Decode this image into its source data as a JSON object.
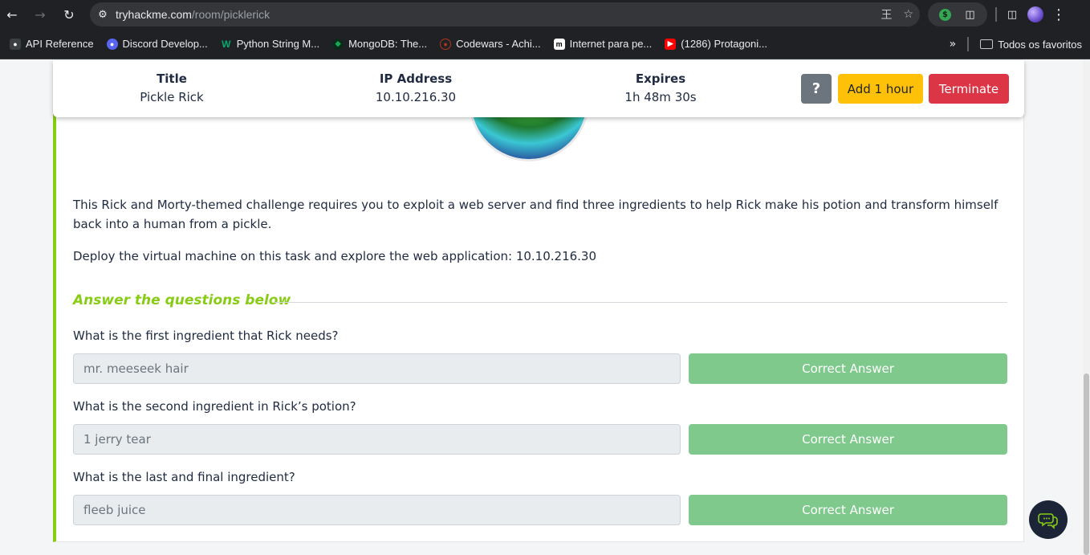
{
  "browser": {
    "url_host": "tryhackme.com",
    "url_path": "/room/picklerick",
    "bookmarks": [
      {
        "label": "API Reference",
        "icon": "api-icon",
        "color": "#5f6368"
      },
      {
        "label": "Discord Develop...",
        "icon": "discord-icon",
        "color": "#5865f2"
      },
      {
        "label": "Python String M...",
        "icon": "w3-icon",
        "color": "#04aa6d"
      },
      {
        "label": "MongoDB: The...",
        "icon": "mongodb-leaf-icon",
        "color": "#13aa52"
      },
      {
        "label": "Codewars - Achi...",
        "icon": "codewars-icon",
        "color": "#b1361e"
      },
      {
        "label": "Internet para pe...",
        "icon": "m-icon",
        "color": "#000000"
      },
      {
        "label": "(1286) Protagoni...",
        "icon": "youtube-icon",
        "color": "#ff0000"
      }
    ],
    "all_bookmarks_label": "Todos os favoritos"
  },
  "machine_bar": {
    "title_label": "Title",
    "title_value": "Pickle Rick",
    "ip_label": "IP Address",
    "ip_value": "10.10.216.30",
    "expires_label": "Expires",
    "expires_value": "1h 48m 30s",
    "help_label": "?",
    "add_hour_label": "Add 1 hour",
    "terminate_label": "Terminate"
  },
  "task": {
    "description": "This Rick and Morty-themed challenge requires you to exploit a web server and find three ingredients to help Rick make his potion and transform himself back into a human from a pickle.",
    "deploy_text": "Deploy the virtual machine on this task and explore the web application: 10.10.216.30",
    "answer_heading": "Answer the questions below",
    "questions": [
      {
        "question": "What is the first ingredient that Rick needs?",
        "answer": "mr. meeseek hair",
        "status": "Correct Answer"
      },
      {
        "question": "What is the second ingredient in Rick’s potion?",
        "answer": "1 jerry tear",
        "status": "Correct Answer"
      },
      {
        "question": "What is the last and final ingredient?",
        "answer": "fleeb juice",
        "status": "Correct Answer"
      }
    ]
  },
  "colors": {
    "accent_green": "#88cc14",
    "correct_green": "#7fc98c",
    "add_hour_yellow": "#ffc107",
    "terminate_red": "#dc3545",
    "help_gray": "#6c757d"
  }
}
